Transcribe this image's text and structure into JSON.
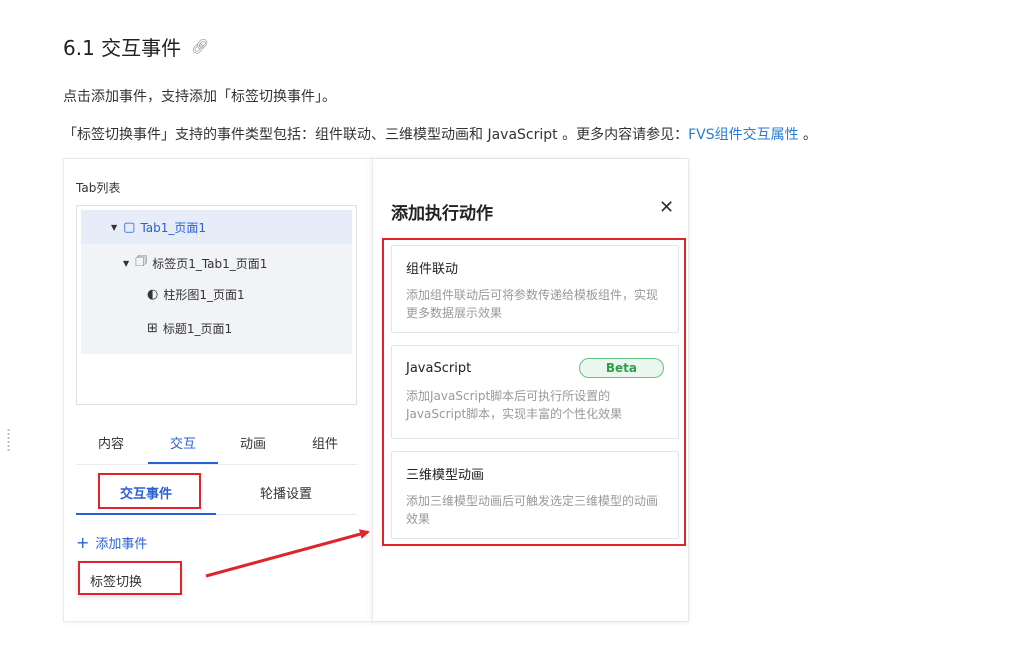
{
  "doc": {
    "title": "6.1 交互事件",
    "link_icon": "link-icon",
    "para1": "点击添加事件，支持添加「标签切换事件」。",
    "para2_prefix": "「标签切换事件」支持的事件类型包括：组件联动、三维模型动画和 JavaScript 。更多内容请参见：",
    "para2_link": "FVS组件交互属性",
    "para2_suffix": " 。"
  },
  "left_panel": {
    "tab_list_label": "Tab列表",
    "tree": [
      {
        "label": "Tab1_页面1",
        "icon": "page-icon"
      },
      {
        "label": "标签页1_Tab1_页面1",
        "icon": "folder-icon"
      },
      {
        "label": "柱形图1_页面1",
        "icon": "pie-chart-icon"
      },
      {
        "label": "标题1_页面1",
        "icon": "text-box-icon"
      }
    ],
    "main_tabs": [
      "内容",
      "交互",
      "动画",
      "组件"
    ],
    "sub_tabs": [
      "交互事件",
      "轮播设置"
    ],
    "add_event": "添加事件",
    "event_item": "标签切换"
  },
  "right_panel": {
    "title": "添加执行动作",
    "close_icon": "close-icon",
    "cards": [
      {
        "title": "组件联动",
        "desc": "添加组件联动后可将参数传递给模板组件，实现更多数据展示效果"
      },
      {
        "title": "JavaScript",
        "badge": "Beta",
        "desc": "添加JavaScript脚本后可执行所设置的JavaScript脚本，实现丰富的个性化效果"
      },
      {
        "title": "三维模型动画",
        "desc": "添加三维模型动画后可触发选定三维模型的动画效果"
      }
    ]
  },
  "colors": {
    "accent": "#2a5fd6",
    "highlight_red": "#e0242b",
    "link": "#2a7bd6",
    "beta_green": "#2f9d49"
  }
}
